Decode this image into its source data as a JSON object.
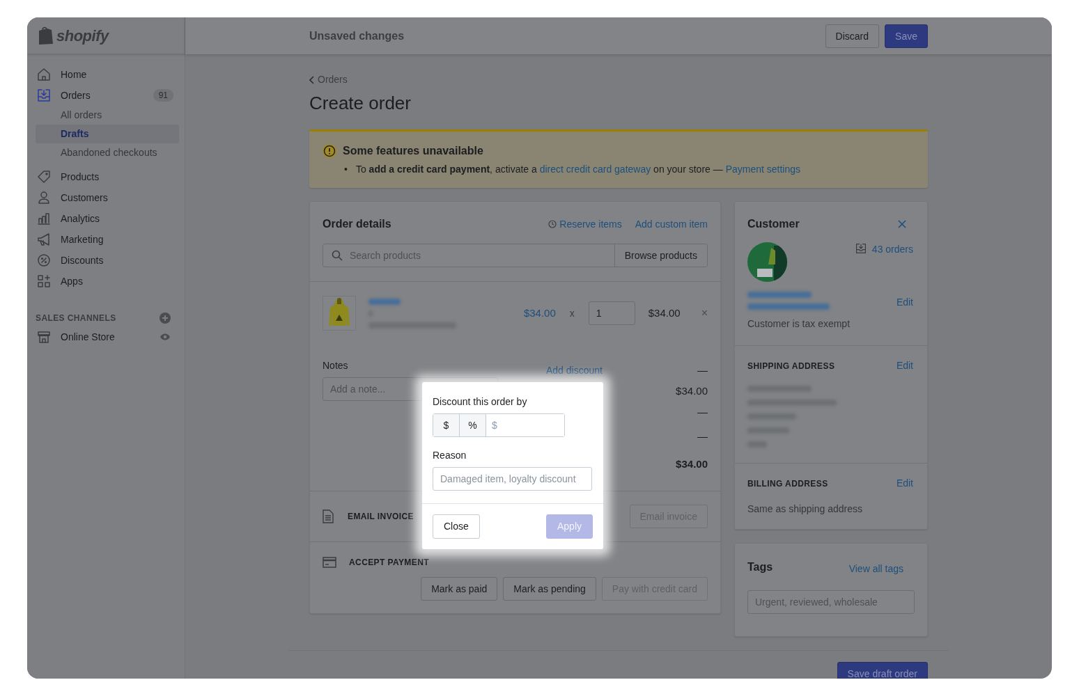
{
  "brand": {
    "name": "shopify"
  },
  "topbar": {
    "title": "Unsaved changes",
    "buttons": [
      {
        "label": "Discard",
        "kind": "secondary"
      },
      {
        "label": "Save",
        "kind": "primary"
      }
    ]
  },
  "sidebar": {
    "items": [
      {
        "label": "Home",
        "kind": "home",
        "selected": false
      },
      {
        "label": "Orders",
        "kind": "orders",
        "selected": true,
        "badge": "91",
        "children": [
          {
            "label": "All orders",
            "selected": false
          },
          {
            "label": "Drafts",
            "selected": true
          },
          {
            "label": "Abandoned checkouts",
            "selected": false
          }
        ]
      },
      {
        "label": "Products",
        "kind": "products",
        "selected": false
      },
      {
        "label": "Customers",
        "kind": "customers",
        "selected": false
      },
      {
        "label": "Analytics",
        "kind": "analytics",
        "selected": false
      },
      {
        "label": "Marketing",
        "kind": "marketing",
        "selected": false
      },
      {
        "label": "Discounts",
        "kind": "discounts",
        "selected": false
      },
      {
        "label": "Apps",
        "kind": "apps",
        "selected": false
      }
    ],
    "section": {
      "title": "SALES CHANNELS",
      "items": [
        {
          "label": "Online Store",
          "kind": "store",
          "selected": false
        }
      ]
    }
  },
  "breadcrumb": "Orders",
  "title": "Create order",
  "banner": {
    "title": "Some features unavailable",
    "bullet": "•",
    "parts": [
      {
        "kind": "text",
        "text": "To **add a credit card payment**, activate a"
      },
      {
        "kind": "link",
        "text": "direct credit card gateway"
      },
      {
        "kind": "text",
        "text": "on your store —"
      },
      {
        "kind": "link",
        "text": "Payment settings"
      }
    ]
  },
  "order_details": {
    "title": "Order details",
    "actions": [
      {
        "label": "Reserve items",
        "kind": "clock"
      },
      {
        "label": "Add custom item",
        "kind": "plain"
      }
    ],
    "search": {
      "placeholder": "Search products"
    },
    "browse_button": "Browse products",
    "line_item": {
      "price": "$34.00",
      "times": "x",
      "quantity": "1",
      "total": "$34.00",
      "remove": "×"
    },
    "notes": {
      "label": "Notes",
      "placeholder": "Add a note..."
    },
    "add_discount": "Add discount",
    "summary": [
      {
        "value": "—",
        "bold": false
      },
      {
        "value": "$34.00",
        "bold": false
      },
      {
        "value": "—",
        "bold": false
      },
      {
        "value": "—",
        "bold": false
      },
      {
        "value": "$34.00",
        "bold": true
      }
    ],
    "sections": [
      {
        "title": "EMAIL INVOICE",
        "kind": "invoice",
        "buttons": [
          {
            "label": "Email invoice",
            "disabled": true
          }
        ]
      },
      {
        "title": "ACCEPT PAYMENT",
        "kind": "payment",
        "buttons": [
          {
            "label": "Mark as paid",
            "disabled": false
          },
          {
            "label": "Mark as pending",
            "disabled": false
          },
          {
            "label": "Pay with credit card",
            "disabled": true
          }
        ]
      }
    ]
  },
  "customer": {
    "title": "Customer",
    "orders": "43 orders",
    "edit": "Edit",
    "note": "Customer is tax exempt",
    "shipping": {
      "title": "SHIPPING ADDRESS",
      "edit": "Edit"
    },
    "billing": {
      "title": "BILLING ADDRESS",
      "edit": "Edit",
      "text": "Same as shipping address"
    }
  },
  "tags": {
    "title": "Tags",
    "link": "View all tags",
    "placeholder": "Urgent, reviewed, wholesale"
  },
  "save_draft": "Save draft order",
  "popover": {
    "label": "Discount this order by",
    "units": [
      "$",
      "%"
    ],
    "amount_placeholder": "$",
    "reason_label": "Reason",
    "reason_placeholder": "Damaged item, loyalty discount",
    "buttons": [
      {
        "label": "Close",
        "kind": "secondary",
        "disabled": false
      },
      {
        "label": "Apply",
        "kind": "primary",
        "disabled": true
      }
    ]
  }
}
